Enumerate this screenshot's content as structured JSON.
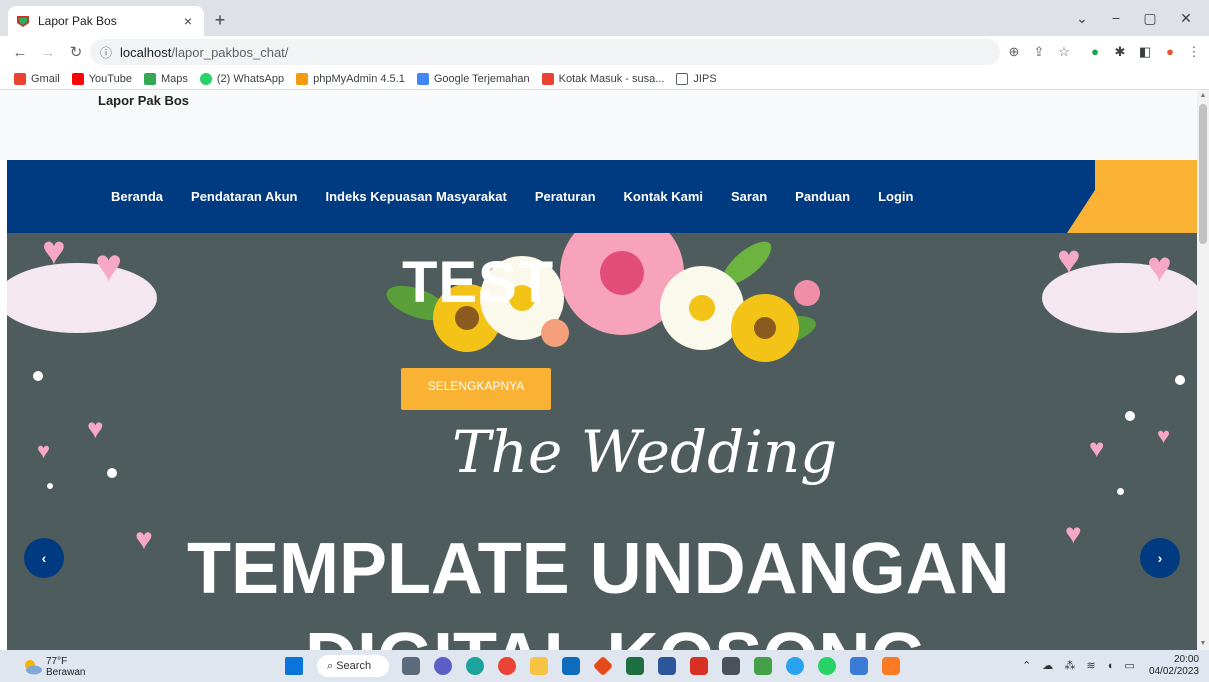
{
  "browser": {
    "tab_title": "Lapor Pak Bos",
    "url_host": "localhost",
    "url_path": "/lapor_pakbos_chat/",
    "tab_close": "×",
    "new_tab": "+"
  },
  "bookmarks": [
    {
      "label": "Gmail",
      "color": "#ea4335"
    },
    {
      "label": "YouTube",
      "color": "#ff0000"
    },
    {
      "label": "Maps",
      "color": "#34a853"
    },
    {
      "label": "(2) WhatsApp",
      "color": "#25d366"
    },
    {
      "label": "phpMyAdmin 4.5.1",
      "color": "#f39c12"
    },
    {
      "label": "Google Terjemahan",
      "color": "#4285f4"
    },
    {
      "label": "Kotak Masuk - susa...",
      "color": "#ea4335"
    },
    {
      "label": "JIPS",
      "color": "#5f6368"
    }
  ],
  "site": {
    "brand": "Lapor Pak Bos",
    "nav": [
      "Beranda",
      "Pendataran Akun",
      "Indeks Kepuasan Masyarakat",
      "Peraturan",
      "Kontak Kami",
      "Saran",
      "Panduan",
      "Login"
    ],
    "hero": {
      "title": "TEST",
      "button": "SELENGKAPNYA",
      "script_text": "The Wedding",
      "big_text": "TEMPLATE UNDANGAN",
      "big_text_2": "DIGITAL KOSONG",
      "prev": "‹",
      "next": "›"
    }
  },
  "taskbar": {
    "temp": "77°F",
    "weather": "Berawan",
    "search": "Search",
    "time": "20:00",
    "date": "04/02/2023"
  },
  "colors": {
    "navbar": "#003a80",
    "accent": "#f9b233",
    "hero_bg": "#4f5c5d"
  }
}
